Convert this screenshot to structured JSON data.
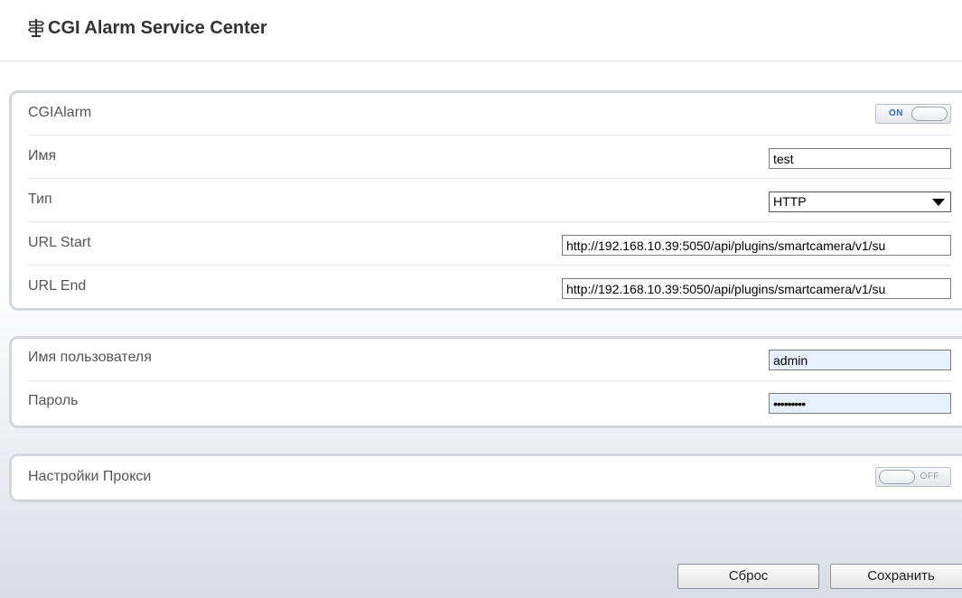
{
  "header": {
    "title": "CGI Alarm Service Center",
    "icon": "signpost-icon"
  },
  "alarm_panel": {
    "enable": {
      "label": "CGIAlarm",
      "state": "ON"
    },
    "name": {
      "label": "Имя",
      "value": "test"
    },
    "type": {
      "label": "Тип",
      "selected": "HTTP"
    },
    "url_start": {
      "label": "URL Start",
      "value": "http://192.168.10.39:5050/api/plugins/smartcamera/v1/su"
    },
    "url_end": {
      "label": "URL End",
      "value": "http://192.168.10.39:5050/api/plugins/smartcamera/v1/su"
    }
  },
  "auth_panel": {
    "username": {
      "label": "Имя пользователя",
      "value": "admin"
    },
    "password": {
      "label": "Пароль",
      "value": "•••••••••"
    }
  },
  "proxy_panel": {
    "label": "Настройки Прокси",
    "state": "OFF"
  },
  "actions": {
    "reset_label": "Сброс",
    "save_label": "Сохранить"
  },
  "colors": {
    "toggle_on_text": "#2d6cc0",
    "panel_border": "#d3d6dc",
    "autofill_bg": "#e8f0fe"
  }
}
